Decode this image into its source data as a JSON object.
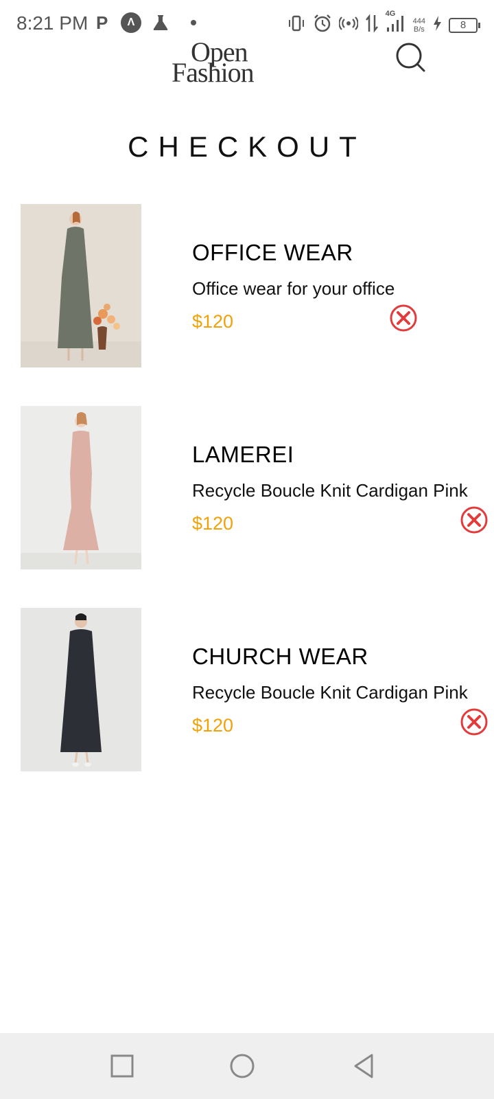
{
  "status_bar": {
    "time": "8:21 PM",
    "net_type": "4G",
    "net_speed_value": "444",
    "net_speed_unit": "B/s",
    "battery": "8",
    "icons": [
      "p-icon",
      "a-icon",
      "flask-icon",
      "dot-icon",
      "vibrate-icon",
      "alarm-icon",
      "hotspot-icon",
      "data-arrows-icon",
      "signal-icon",
      "charging-icon",
      "battery-icon"
    ]
  },
  "header": {
    "logo_line1": "Open",
    "logo_line2": "Fashion",
    "search_icon": "search-icon"
  },
  "page": {
    "title": "CHECKOUT"
  },
  "items": [
    {
      "name": "OFFICE WEAR",
      "description": "Office wear for your office",
      "price": "$120",
      "dress_color": "#6f7468",
      "bg_color": "#e3ddd3"
    },
    {
      "name": "LAMEREI",
      "description": "Recycle Boucle Knit Cardigan Pink",
      "price": "$120",
      "dress_color": "#dcb0a5",
      "bg_color": "#ececea"
    },
    {
      "name": "CHURCH WEAR",
      "description": "Recycle Boucle Knit Cardigan Pink",
      "price": "$120",
      "dress_color": "#2c2f35",
      "bg_color": "#e6e6e4"
    }
  ],
  "colors": {
    "price": "#f0a20a",
    "remove": "#e23b3b",
    "nav_bar": "#efefef"
  },
  "nav": {
    "icons": [
      "recents-icon",
      "home-icon",
      "back-icon"
    ]
  }
}
